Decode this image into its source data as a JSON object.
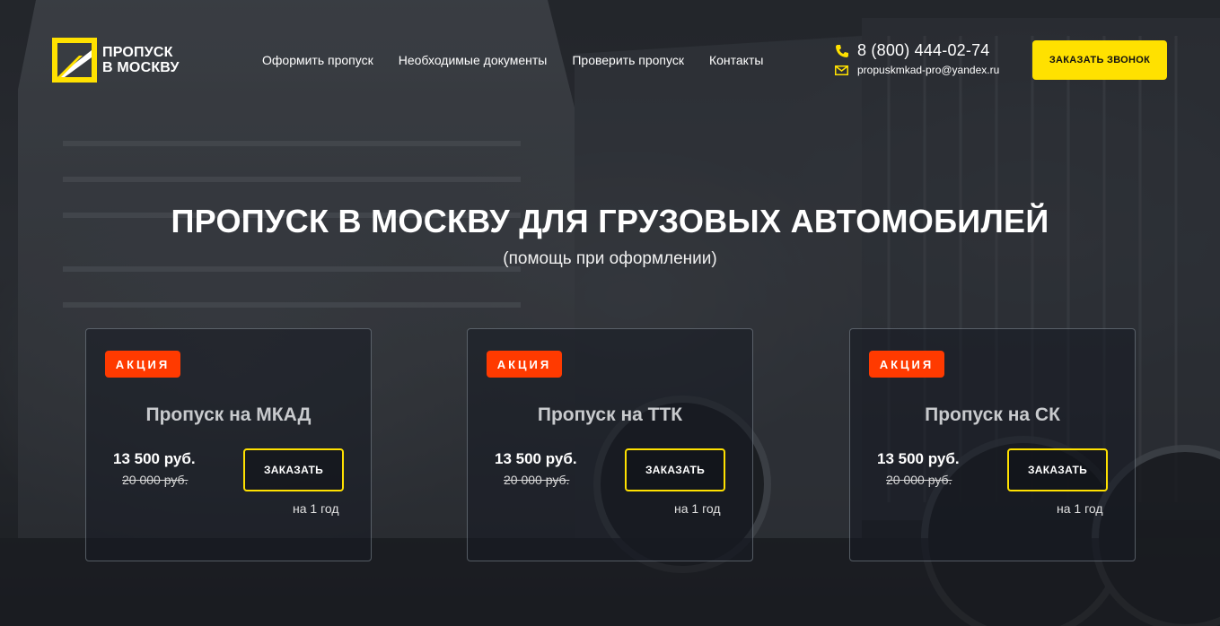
{
  "header": {
    "logo_line1": "ПРОПУСК",
    "logo_line2": "В МОСКВУ",
    "nav": [
      {
        "label": "Оформить пропуск"
      },
      {
        "label": "Необходимые документы"
      },
      {
        "label": "Проверить пропуск"
      },
      {
        "label": "Контакты"
      }
    ],
    "phone": "8 (800) 444-02-74",
    "email": "propuskmkad-pro@yandex.ru",
    "call_button": "ЗАКАЗАТЬ ЗВОНОК"
  },
  "hero": {
    "title": "ПРОПУСК В МОСКВУ ДЛЯ ГРУЗОВЫХ АВТОМОБИЛЕЙ",
    "subtitle": "(помощь при оформлении)"
  },
  "cards": [
    {
      "badge": "АКЦИЯ",
      "title": "Пропуск на МКАД",
      "price": "13 500 руб.",
      "old_price": "20 000 руб.",
      "button": "ЗАКАЗАТЬ",
      "period": "на 1 год"
    },
    {
      "badge": "АКЦИЯ",
      "title": "Пропуск на ТТК",
      "price": "13 500 руб.",
      "old_price": "20 000 руб.",
      "button": "ЗАКАЗАТЬ",
      "period": "на 1 год"
    },
    {
      "badge": "АКЦИЯ",
      "title": "Пропуск на СК",
      "price": "13 500 руб.",
      "old_price": "20 000 руб.",
      "button": "ЗАКАЗАТЬ",
      "period": "на 1 год"
    }
  ],
  "colors": {
    "accent": "#ffe100",
    "badge": "#ff3a00",
    "background": "#2b2e33"
  },
  "icons": {
    "logo": "road-logo-icon",
    "phone": "phone-icon",
    "mail": "mail-icon"
  }
}
